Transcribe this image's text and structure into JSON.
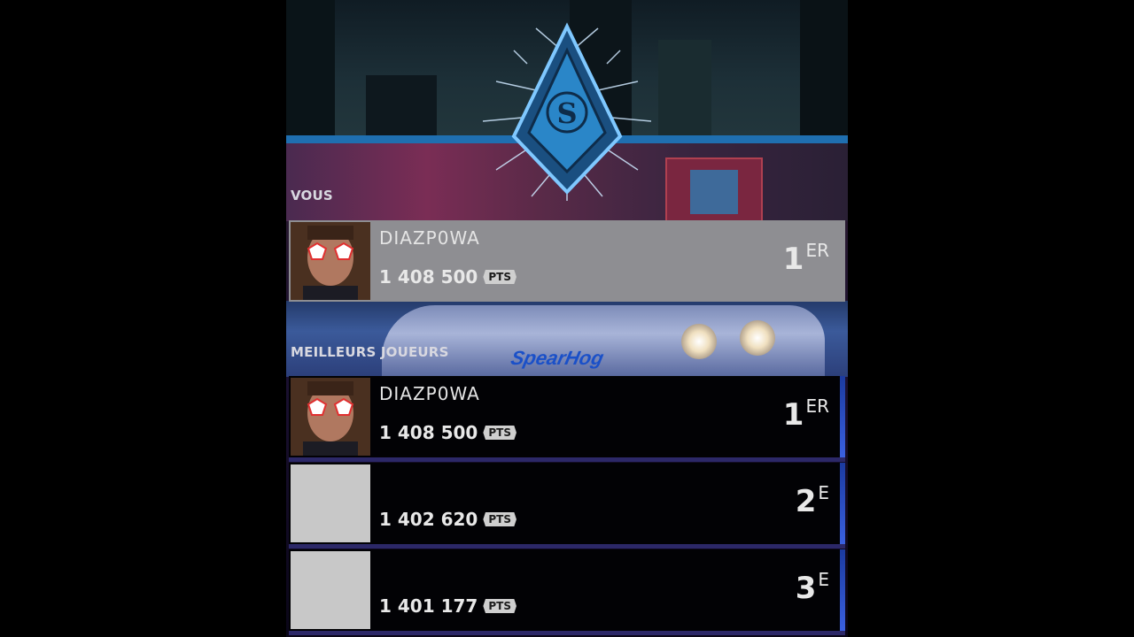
{
  "emblem": {
    "letter": "S"
  },
  "you_section": {
    "label": "VOUS",
    "entry": {
      "name": "DIAZP0WA",
      "points": "1 408 500",
      "points_unit": "PTS",
      "rank_num": "1",
      "rank_suffix": "ER"
    }
  },
  "top_section": {
    "label": "MEILLEURS JOUEURS",
    "entries": [
      {
        "name": "DIAZP0WA",
        "points": "1 408 500",
        "points_unit": "PTS",
        "rank_num": "1",
        "rank_suffix": "ER"
      },
      {
        "name": "",
        "points": "1 402 620",
        "points_unit": "PTS",
        "rank_num": "2",
        "rank_suffix": "E"
      },
      {
        "name": "",
        "points": "1 401 177",
        "points_unit": "PTS",
        "rank_num": "3",
        "rank_suffix": "E"
      }
    ]
  },
  "background": {
    "car_brand_text": "SpearHog"
  },
  "colors": {
    "accent_blue": "#1f6fb0",
    "row_highlight": "#8e8e92",
    "row_dark": "#020205"
  }
}
